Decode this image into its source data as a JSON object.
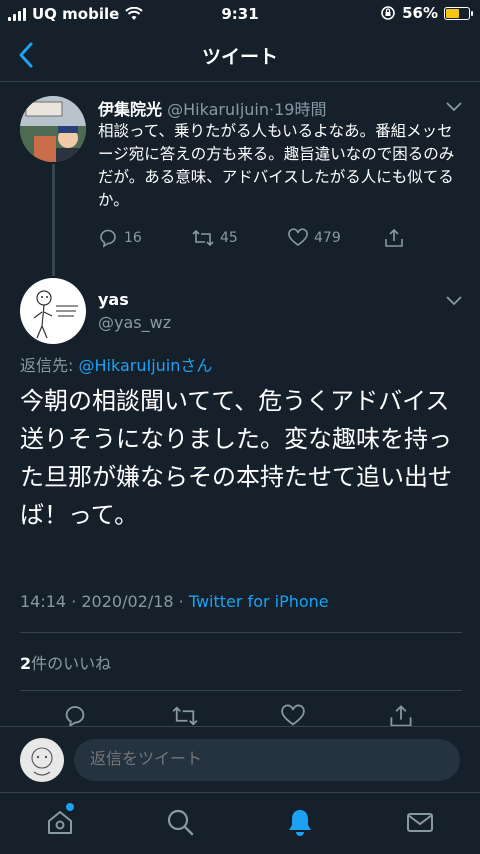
{
  "status_bar": {
    "carrier": "UQ mobile",
    "time": "9:31",
    "battery": "56%"
  },
  "nav": {
    "title": "ツイート"
  },
  "parent_tweet": {
    "name": "伊集院光",
    "handle": "@HikaruIjuin",
    "time": "19時間",
    "text": "相談って、乗りたがる人もいるよなあ。番組メッセージ宛に答えの方も来る。趣旨違いなので困るのみだが。ある意味、アドバイスしたがる人にも似てるか。",
    "replies": "16",
    "retweets": "45",
    "likes": "479"
  },
  "main_tweet": {
    "name": "yas",
    "handle": "@yas_wz",
    "reply_prefix": "返信先: ",
    "reply_target": "@HikaruIjuin",
    "reply_suffix": "さん",
    "text": "今朝の相談聞いてて、危うくアドバイス送りそうになりました。変な趣味を持った旦那が嫌ならその本持たせて追い出せば！って。",
    "datetime": "14:14 · 2020/02/18 · ",
    "source": "Twitter for iPhone",
    "likes_count": "2",
    "likes_label": "件のいいね"
  },
  "reply_bar": {
    "placeholder": "返信をツイート"
  },
  "colors": {
    "background": "#15202b",
    "accent": "#1da1f2",
    "secondary_text": "#8899a6",
    "divider": "#38444d"
  }
}
